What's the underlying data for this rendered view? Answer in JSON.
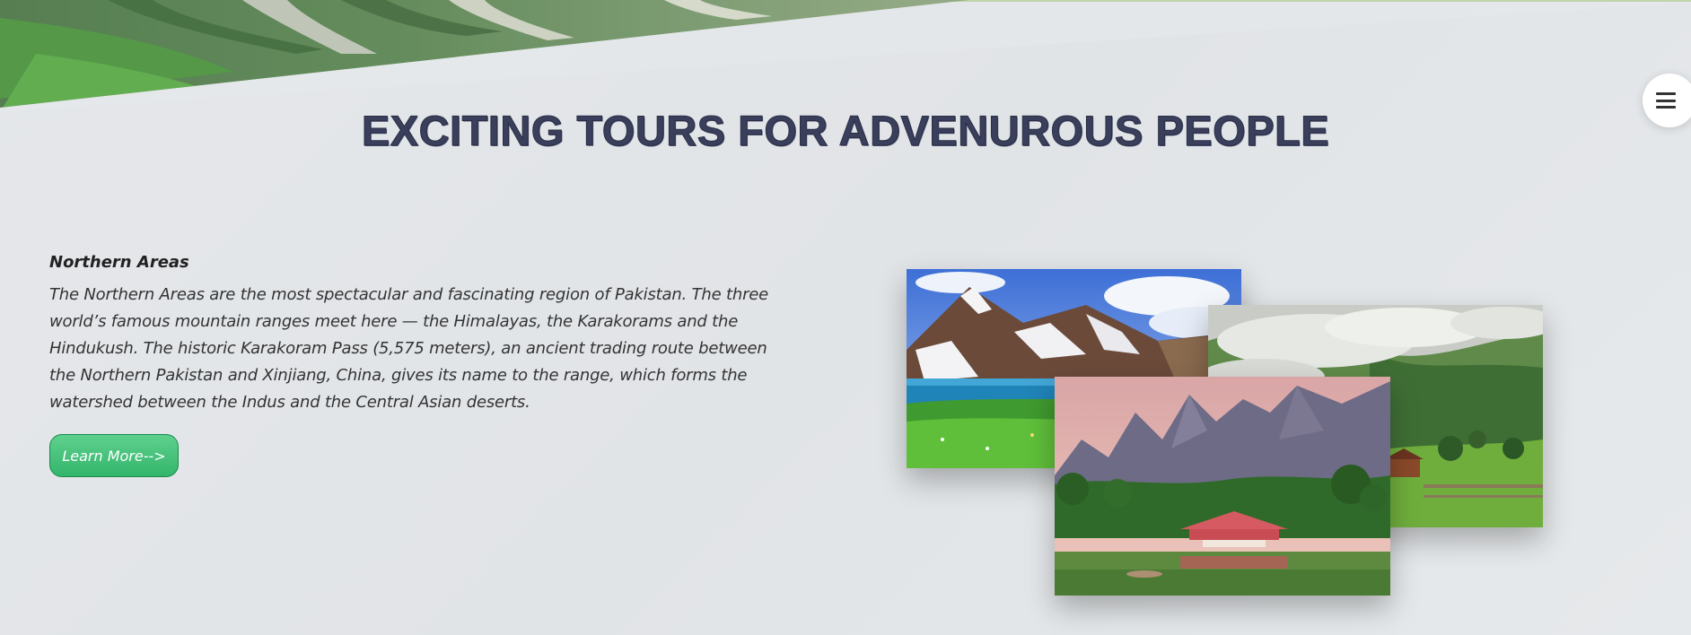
{
  "header": {
    "title": "EXCITING TOURS FOR ADVENUROUS PEOPLE",
    "menu_icon": "hamburger-icon"
  },
  "section": {
    "heading": "Northern Areas",
    "body": "The Northern Areas are the most spectacular and fascinating region of Pakistan. The three world’s famous mountain ranges meet here — the Himalayas, the Karakorams and the Hindukush. The historic Karakoram Pass (5,575 meters), an ancient trading route between the Northern Pakistan and Xinjiang, China, gives its name to the range, which forms the watershed between the Indus and the Central Asian deserts.",
    "button_label": "Learn More-->"
  },
  "colors": {
    "title": "#3a3f5c",
    "button": "#33b56c",
    "background": "#e3e6e9"
  }
}
